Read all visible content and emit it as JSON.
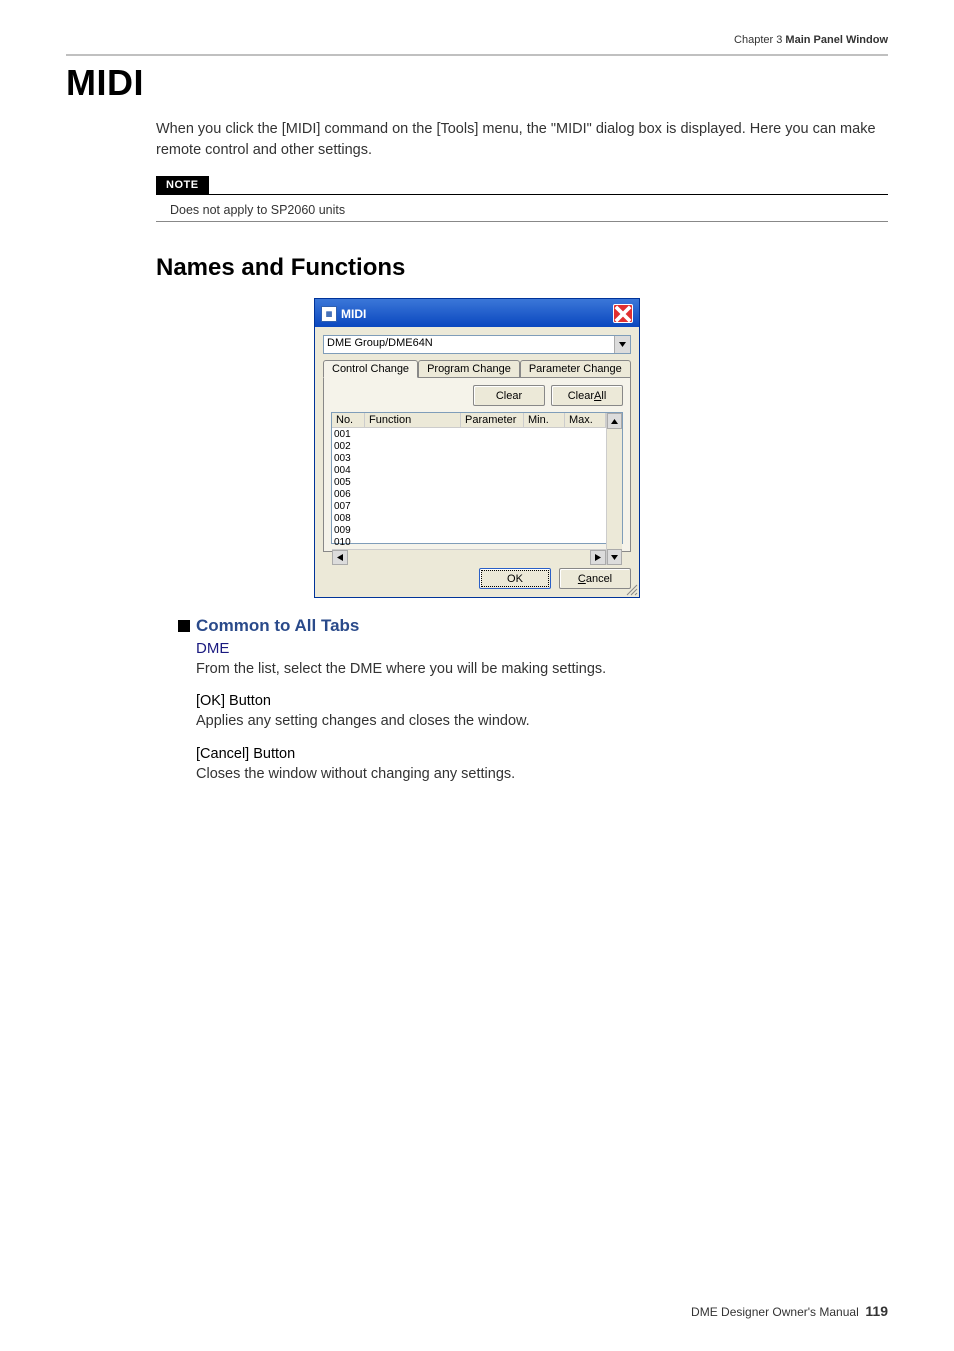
{
  "header": {
    "chapter": "Chapter 3",
    "title": "Main Panel Window"
  },
  "h1": "MIDI",
  "intro": "When you click the [MIDI] command on the [Tools] menu, the \"MIDI\" dialog box is displayed. Here you can make remote control and other settings.",
  "note": {
    "label": "NOTE",
    "text": "Does not apply to SP2060 units"
  },
  "h2": "Names and Functions",
  "dialog": {
    "title": "MIDI",
    "combo": "DME Group/DME64N",
    "tabs": [
      "Control Change",
      "Program Change",
      "Parameter Change"
    ],
    "clear": "Clear",
    "clear_all_pre": "Clear ",
    "clear_all_u": "A",
    "clear_all_post": "ll",
    "cols": {
      "no": "No.",
      "fn": "Function",
      "pa": "Parameter",
      "mi": "Min.",
      "ma": "Max."
    },
    "rows": [
      "001",
      "002",
      "003",
      "004",
      "005",
      "006",
      "007",
      "008",
      "009",
      "010"
    ],
    "ok": "OK",
    "cancel_u": "C",
    "cancel_post": "ancel"
  },
  "sections": {
    "common_title": "Common to All Tabs",
    "dme_title": "DME",
    "dme_desc": "From the list, select the DME where you will be making settings.",
    "ok_title": "[OK] Button",
    "ok_desc": "Applies any setting changes and closes the window.",
    "cancel_title": "[Cancel] Button",
    "cancel_desc": "Closes the window without changing any settings."
  },
  "footer": {
    "text": "DME Designer Owner's Manual",
    "page": "119"
  }
}
